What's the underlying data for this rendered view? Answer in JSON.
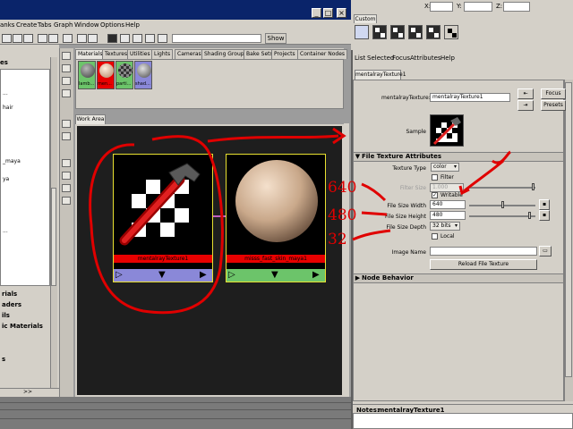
{
  "left_window": {
    "menu": [
      "anks",
      "Create",
      "Tabs",
      "Graph",
      "Window",
      "Options",
      "Help"
    ],
    "show_button": "Show",
    "left_list": {
      "header": "es",
      "items": [
        "...",
        "...",
        "...",
        "hair",
        "...",
        "_maya",
        "...",
        "ya",
        "...",
        "...",
        "..."
      ],
      "bold_items": [
        "rials",
        "aders",
        "ils",
        "ic Materials",
        "s"
      ],
      "collapse": ">>"
    },
    "tabs": [
      "Materials",
      "Textures",
      "Utilities",
      "Lights",
      "Cameras",
      "Shading Groups",
      "Bake Sets",
      "Projects",
      "Container Nodes"
    ],
    "swatches": [
      {
        "label": "lamb..."
      },
      {
        "label": "men..."
      },
      {
        "label": "parti..."
      },
      {
        "label": "shad..."
      }
    ],
    "work_area_tab": "Work Area",
    "nodes": [
      {
        "name": "mentalrayTexture1",
        "color": "#8a88d8"
      },
      {
        "name": "misss_fast_skin_maya1",
        "color": "#6cc46a"
      }
    ]
  },
  "right_panel": {
    "top_fields": {
      "x_label": "X:",
      "y_label": "Y:",
      "z_label": "Z:"
    },
    "custom_tab": "Custom",
    "menu": [
      "List",
      "Selected",
      "Focus",
      "Attributes",
      "Help"
    ],
    "node_tab": "mentalrayTexture1",
    "name_label": "mentalrayTexture:",
    "name_value": "mentalrayTexture1",
    "focus_button": "Focus",
    "presets_button": "Presets",
    "sample_label": "Sample",
    "section_title": "File Texture Attributes",
    "texture_type_label": "Texture Type",
    "texture_type_value": "color",
    "filter_label": "Filter",
    "filter_size_label": "Filter Size",
    "filter_size_value": "1.000",
    "writable_label": "Writable",
    "width_label": "File Size Width",
    "width_value": "640",
    "height_label": "File Size Height",
    "height_value": "480",
    "depth_label": "File Size Depth",
    "depth_value": "32 bits",
    "local_label": "Local",
    "image_name_label": "Image Name",
    "reload_button": "Reload File Texture",
    "node_behavior": "Node Behavior",
    "notes_label": "Notes:",
    "notes_value": "mentalrayTexture1"
  },
  "annotations": {
    "width": "640",
    "height": "480",
    "depth": "32"
  },
  "colors": {
    "annotation": "#e00000",
    "node_name_bar": "#e80000",
    "node_border": "#e8e030"
  }
}
